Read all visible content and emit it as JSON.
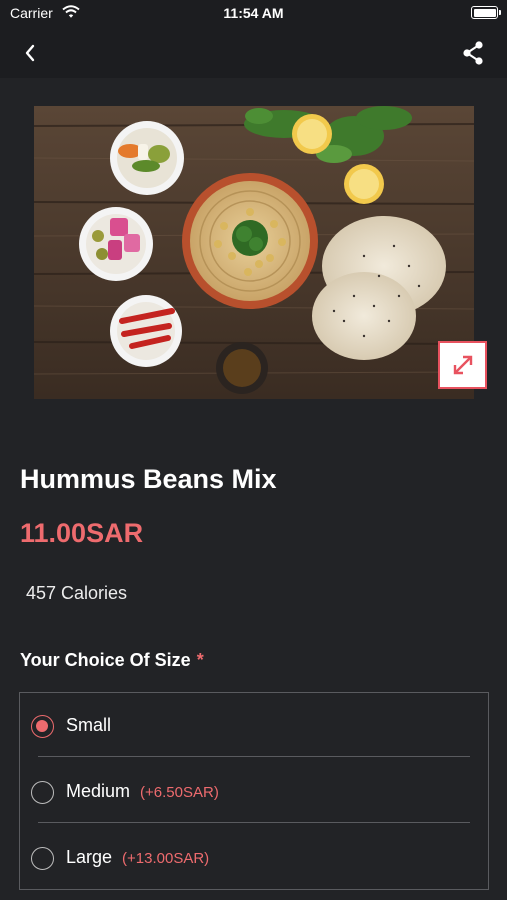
{
  "status_bar": {
    "carrier": "Carrier",
    "time": "11:54 AM"
  },
  "nav": {
    "back_icon": "chevron-left-icon",
    "share_icon": "share-icon"
  },
  "hero": {
    "expand_icon": "expand-arrows-icon"
  },
  "product": {
    "title": "Hummus Beans Mix",
    "price": "11.00SAR",
    "calories": "457 Calories"
  },
  "size_section": {
    "heading": "Your Choice Of Size",
    "required_mark": "*",
    "options": [
      {
        "label": "Small",
        "extra": "",
        "selected": true
      },
      {
        "label": "Medium",
        "extra": "(+6.50SAR)",
        "selected": false
      },
      {
        "label": "Large",
        "extra": "(+13.00SAR)",
        "selected": false
      }
    ]
  },
  "colors": {
    "accent": "#ee6b6e",
    "background": "#222326"
  }
}
